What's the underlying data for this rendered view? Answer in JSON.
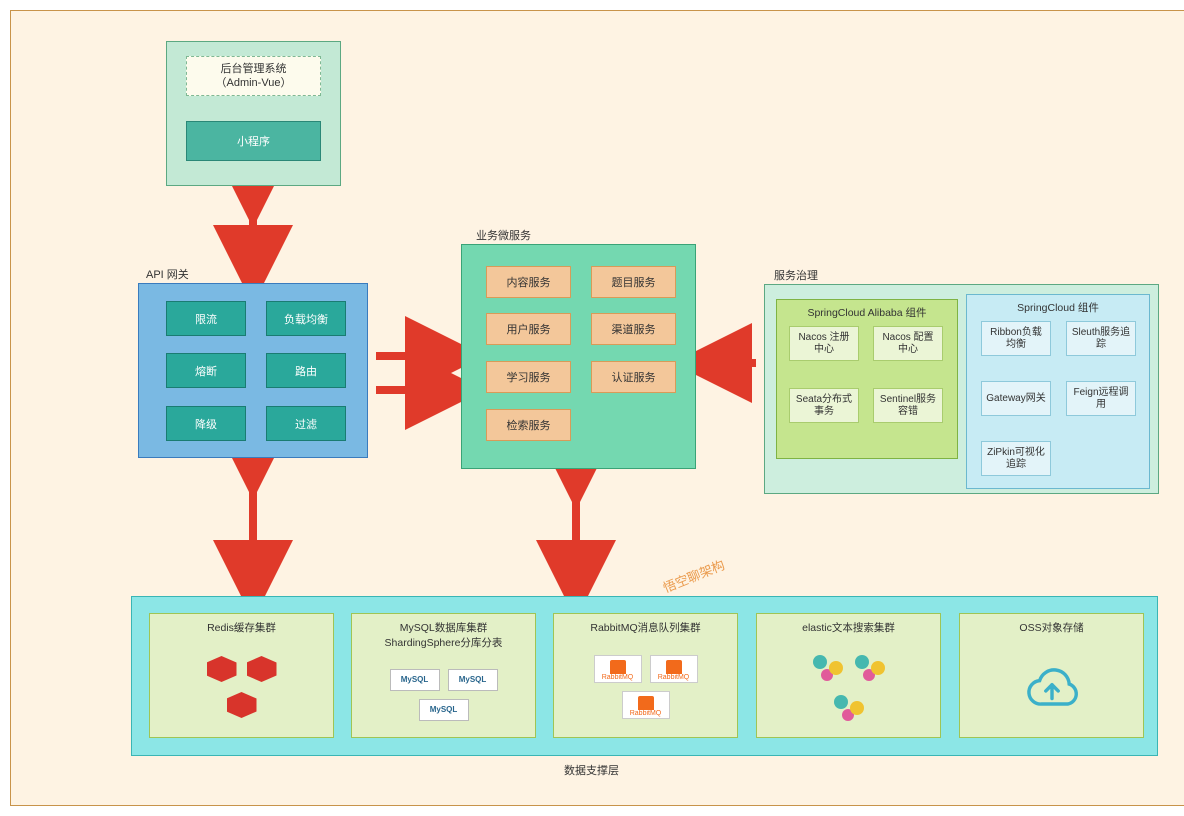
{
  "frontend": {
    "admin": "后台管理系统\n（Admin-Vue）",
    "miniprogram": "小程序"
  },
  "api_gateway": {
    "label": "API 网关",
    "cells": [
      "限流",
      "负载均衡",
      "熔断",
      "路由",
      "降级",
      "过滤"
    ]
  },
  "microservices": {
    "label": "业务微服务",
    "cells": [
      "内容服务",
      "题目服务",
      "用户服务",
      "渠道服务",
      "学习服务",
      "认证服务",
      "检索服务"
    ]
  },
  "governance": {
    "label": "服务治理",
    "alibaba_label": "SpringCloud Alibaba 组件",
    "alibaba": [
      "Nacos 注册中心",
      "Nacos 配置中心",
      "Seata分布式事务",
      "Sentinel服务容错"
    ],
    "spring_label": "SpringCloud 组件",
    "spring": [
      "Ribbon负载均衡",
      "Sleuth服务追踪",
      "Gateway网关",
      "Feign远程调用",
      "ZiPkin可视化追踪"
    ]
  },
  "data_layer": {
    "label": "数据支撑层",
    "cells": [
      "Redis缓存集群",
      "MySQL数据库集群\nShardingSphere分库分表",
      "RabbitMQ消息队列集群",
      "elastic文本搜索集群",
      "OSS对象存储"
    ]
  },
  "watermark": "悟空聊架构",
  "icons": {
    "mysql": "MySQL",
    "rabbit": "RabbitMQ"
  }
}
